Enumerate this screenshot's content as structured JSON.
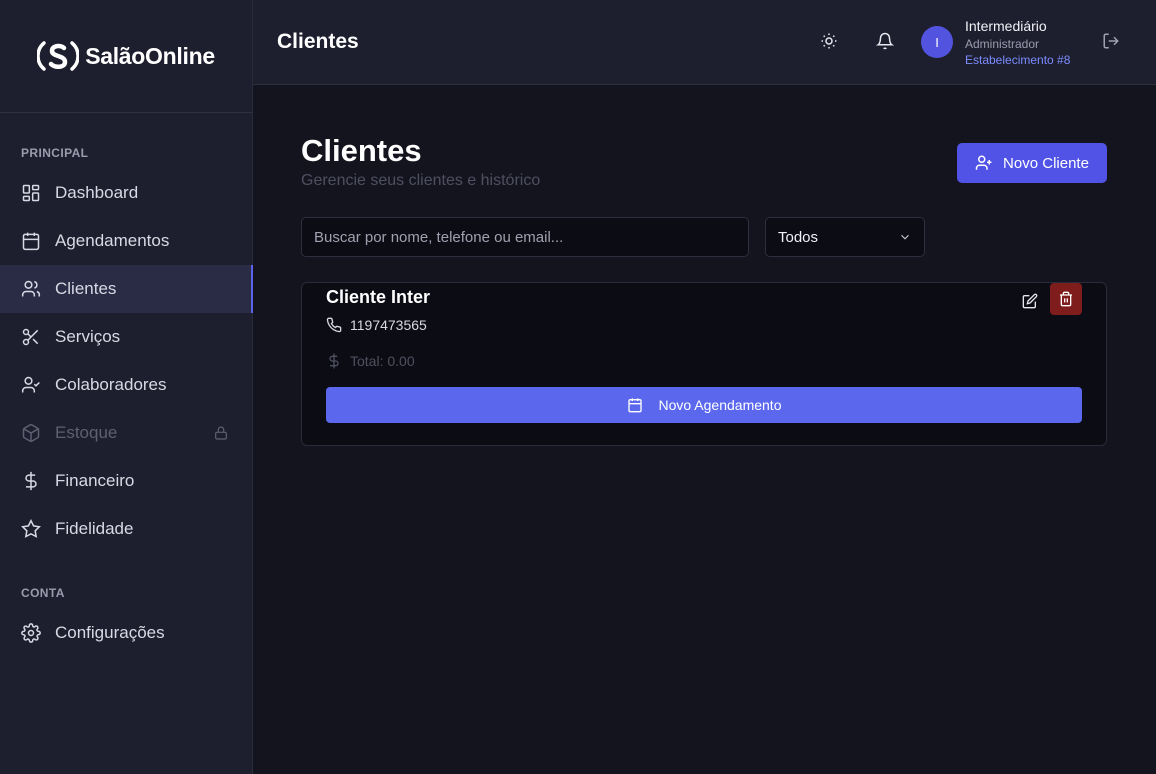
{
  "app": {
    "logo_text": "SalãoOnline"
  },
  "sidebar": {
    "section_principal": "PRINCIPAL",
    "section_conta": "CONTA",
    "items": [
      {
        "label": "Dashboard",
        "icon": "layout-dashboard-icon",
        "active": false,
        "disabled": false
      },
      {
        "label": "Agendamentos",
        "icon": "calendar-icon",
        "active": false,
        "disabled": false
      },
      {
        "label": "Clientes",
        "icon": "users-icon",
        "active": true,
        "disabled": false
      },
      {
        "label": "Serviços",
        "icon": "scissors-icon",
        "active": false,
        "disabled": false
      },
      {
        "label": "Colaboradores",
        "icon": "user-check-icon",
        "active": false,
        "disabled": false
      },
      {
        "label": "Estoque",
        "icon": "package-icon",
        "active": false,
        "disabled": true
      },
      {
        "label": "Financeiro",
        "icon": "dollar-sign-icon",
        "active": false,
        "disabled": false
      },
      {
        "label": "Fidelidade",
        "icon": "star-icon",
        "active": false,
        "disabled": false
      }
    ],
    "settings_label": "Configurações"
  },
  "header": {
    "title": "Clientes",
    "user": {
      "initial": "I",
      "name": "Intermediário",
      "role": "Administrador",
      "establishment": "Estabelecimento #8"
    }
  },
  "main": {
    "title": "Clientes",
    "subtitle": "Gerencie seus clientes e histórico",
    "new_client_label": "Novo Cliente",
    "search_placeholder": "Buscar por nome, telefone ou email...",
    "filter_value": "Todos",
    "clients": [
      {
        "name": "Cliente Inter",
        "phone": "1197473565",
        "total": "Total: 0.00",
        "action_label": "Novo Agendamento"
      }
    ]
  },
  "colors": {
    "accent": "#5153e6",
    "active_border": "#5b61e8",
    "danger": "#7f1d1d",
    "background": "#14141f",
    "sidebar": "#1e1f2e"
  }
}
